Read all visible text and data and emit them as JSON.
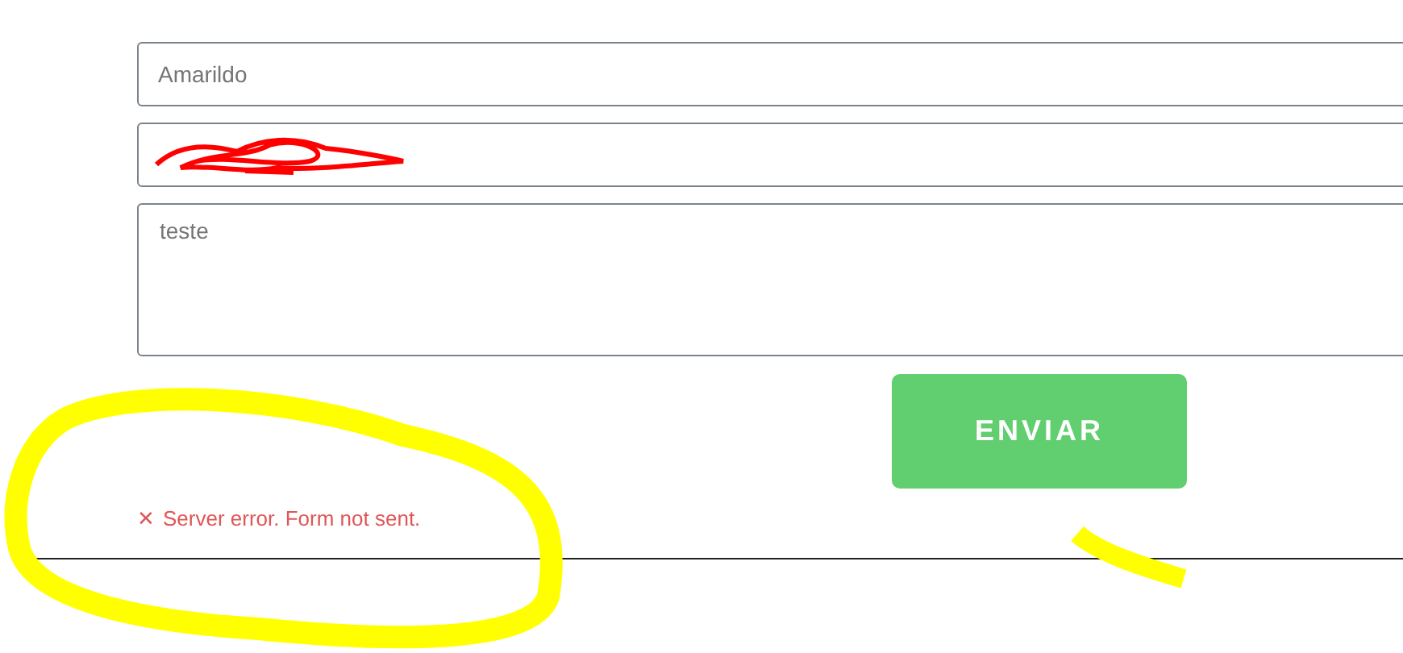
{
  "form": {
    "name_value": "Amarildo",
    "message_value": "teste",
    "submit": "ENVIAR",
    "error": {
      "icon": "✕",
      "text": "Server error. Form not sent."
    }
  }
}
